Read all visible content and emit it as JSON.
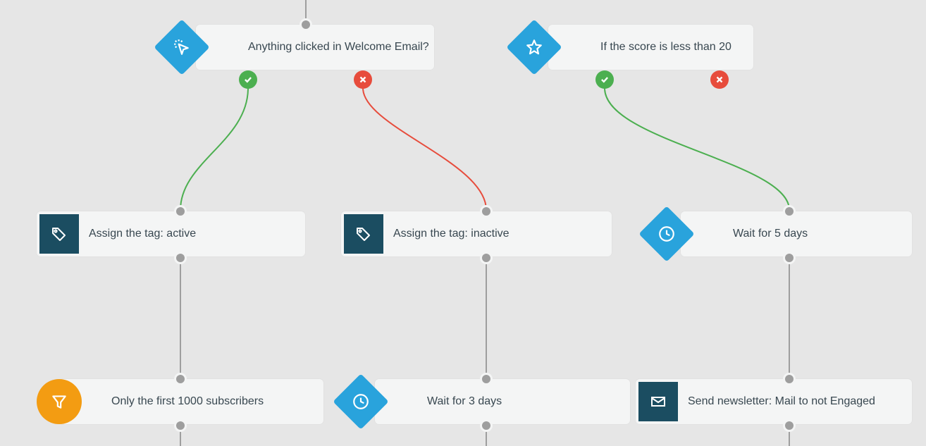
{
  "nodes": {
    "cond_click": {
      "label": "Anything clicked in Welcome Email?"
    },
    "cond_score": {
      "label": "If the score is less than 20"
    },
    "tag_active": {
      "label": "Assign the tag: active"
    },
    "tag_inactive": {
      "label": "Assign the tag: inactive"
    },
    "wait5": {
      "label": "Wait for 5 days"
    },
    "first1000": {
      "label": "Only the first 1000 subscribers"
    },
    "wait3": {
      "label": "Wait for 3 days"
    },
    "send_mail": {
      "label": "Send newsletter: Mail to not Engaged"
    }
  },
  "colors": {
    "blue": "#29a3dc",
    "teal": "#1b4d61",
    "orange": "#f39c12",
    "yes": "#4caf50",
    "no": "#e74c3c",
    "wire": "#9e9e9e"
  },
  "icons": {
    "click": "cursor-click-icon",
    "star": "star-icon",
    "tag": "tag-icon",
    "clock": "clock-icon",
    "funnel": "funnel-icon",
    "mail": "mail-icon",
    "check": "check-icon",
    "cross": "cross-icon"
  }
}
